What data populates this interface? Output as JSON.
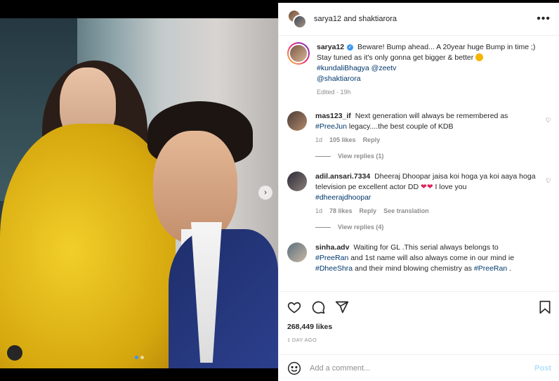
{
  "header": {
    "title": "sarya12 and shaktiarora",
    "more_icon": "more-icon"
  },
  "caption": {
    "user": "sarya12",
    "text_before": "Beware! Bump ahead... A 20year huge Bump in time ;) Stay tuned as it's only gonna get bigger & better",
    "tag1": "#kundaliBhagya",
    "tag2": "@zeetv",
    "tag3": "@shaktiarora",
    "meta": "Edited · 19h"
  },
  "comments": [
    {
      "user": "mas123_if",
      "text": "Next generation will always be remembered as",
      "tag": "#PreeJun",
      "text2": "legacy....the best couple of KDB",
      "time": "1d",
      "likes": "105 likes",
      "reply": "Reply",
      "view_replies": "View replies (1)"
    },
    {
      "user": "adil.ansari.7334",
      "text": "Dheeraj Dhoopar jaisa koi hoga ya koi aaya hoga television pe excellent actor DD",
      "text2": "I love you",
      "tag": "#dheerajdhoopar",
      "time": "1d",
      "likes": "78 likes",
      "reply": "Reply",
      "translate": "See translation",
      "view_replies": "View replies (4)"
    },
    {
      "user": "sinha.adv",
      "text": "Waiting for GL .This serial always belongs to",
      "tag": "#PreeRan",
      "text2": "and 1st name will also always come in our mind ie",
      "tag2": "#DheeShra",
      "text3": "and their mind blowing chemistry as",
      "tag3": "#PreeRan",
      "text4": "."
    }
  ],
  "actions": {
    "likes": "268,449 likes",
    "ago": "1 DAY AGO"
  },
  "add_comment": {
    "placeholder": "Add a comment...",
    "post": "Post"
  },
  "colors": {
    "link": "#00376b",
    "muted": "#8e8e8e",
    "post": "#b2dffc"
  }
}
